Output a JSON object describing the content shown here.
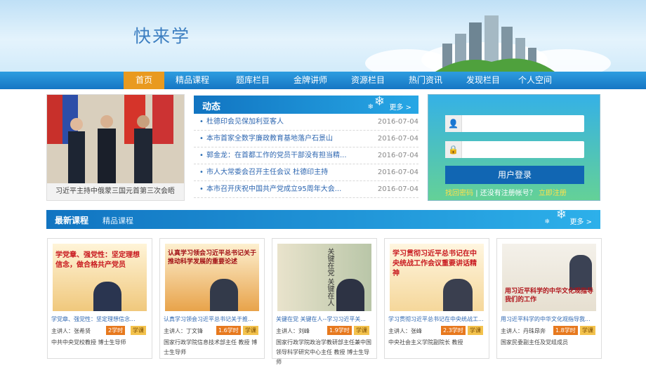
{
  "header": {
    "logo": "快来学"
  },
  "nav": {
    "items": [
      "首页",
      "精品课程",
      "题库栏目",
      "金牌讲师",
      "资源栏目",
      "热门资讯",
      "发现栏目",
      "个人空间"
    ],
    "active_index": 0
  },
  "news_photo": {
    "caption": "习近平主持中俄蒙三国元首第三次会晤"
  },
  "dongtai": {
    "title": "动态",
    "more": "更多 >",
    "items": [
      {
        "title": "杜德印会见保加利亚客人",
        "date": "2016-07-04"
      },
      {
        "title": "本市首家全数字廉政教育基地落户石景山",
        "date": "2016-07-04"
      },
      {
        "title": "郭金龙：在首都工作的党员干部没有担当精...",
        "date": "2016-07-04"
      },
      {
        "title": "市人大常委会召开主任会议 杜德印主持",
        "date": "2016-07-04"
      },
      {
        "title": "本市召开庆祝中国共产党成立95周年大会...",
        "date": "2016-07-04"
      }
    ]
  },
  "login": {
    "button": "用户登录",
    "forgot": "找回密码",
    "no_account": "| 还没有注册帐号？",
    "register": "立即注册"
  },
  "courses": {
    "title": "最新课程",
    "tab": "精品课程",
    "more": "更多 >",
    "lecturer_label": "主讲人：",
    "items": [
      {
        "title": "学党章、强党性：坚定理想信念...",
        "lecturer": "张希贤",
        "hours": "2学时",
        "tag": "学课",
        "desc": "中共中央党校教授 博士生导师",
        "thumb_text": "学党章、强党性：坚定理想信念，做合格共产党员"
      },
      {
        "title": "认真学习领会习近平总书记关于推...",
        "lecturer": "丁文锋",
        "hours": "1.6学时",
        "tag": "学课",
        "desc": "国家行政学院信息技术部主任 教授 博士生导师",
        "thumb_text": "认真学习领会习近平总书记关于推动科学发展的重要论述"
      },
      {
        "title": "关键在党 关键在人--学习习近平关...",
        "lecturer": "刘峰",
        "hours": "1.9学时",
        "tag": "学课",
        "desc": "国家行政学院政治学教研部主任兼中国领导科学研究中心主任 教授 博士生导师",
        "thumb_text": "关键在党 关键在人"
      },
      {
        "title": "学习贯彻习近平总书记在中央统战工...",
        "lecturer": "张峰",
        "hours": "2.3学时",
        "tag": "学课",
        "desc": "中央社会主义学院副院长 教授",
        "thumb_text": "学习贯彻习近平总书记在中央统战工作会议重要讲话精神"
      },
      {
        "title": "用习近平科学的中华文化观指导我...",
        "lecturer": "丹珠昂奔",
        "hours": "1.8学时",
        "tag": "学课",
        "desc": "国家民委副主任及党组成员",
        "thumb_text": "用习近平科学的中华文化观指导我们的工作"
      }
    ]
  }
}
